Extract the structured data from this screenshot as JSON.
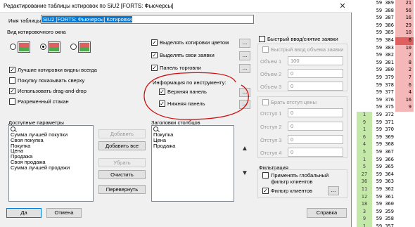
{
  "window": {
    "title": "Редактирование таблицы котировок по SiU2 [FORTS: Фьючерсы]",
    "close": "✕"
  },
  "table_name": {
    "label": "Имя таблицы",
    "value": "SiU2 [FORTS: Фьючерсы] Котировки"
  },
  "view": {
    "label": "Вид котировочного окна",
    "options": [
      "best_quotes_bottom",
      "best_quotes_middle",
      "best_quotes_top"
    ],
    "selected_index": 1
  },
  "checks_left": [
    {
      "label": "Лучшие котировки видны всегда",
      "checked": true
    },
    {
      "label": "Покупку показывать сверху",
      "checked": false
    },
    {
      "label": "Использовать drag-and-drop",
      "checked": true
    },
    {
      "label": "Разреженный стакан",
      "checked": false
    }
  ],
  "checks_mid": [
    {
      "label": "Выделять котировки цветом",
      "checked": true
    },
    {
      "label": "Выделять свои заявки",
      "checked": true
    },
    {
      "label": "Панель торговли",
      "checked": true
    }
  ],
  "info_group": {
    "label": "Информация по инструменту:",
    "items": [
      {
        "label": "Верхняя панель",
        "checked": true
      },
      {
        "label": "Нижняя панель",
        "checked": true
      }
    ]
  },
  "dots": "...",
  "available": {
    "label": "Доступные параметры",
    "items": [
      "Сумма лучшей покупки",
      "Своя покупка",
      "Покупка",
      "Цена",
      "Продажа",
      "Своя продажа",
      "Сумма лучшей продажи"
    ]
  },
  "headers": {
    "label": "Заголовки столбцов",
    "items": [
      "Покупка",
      "Цена",
      "Продажа"
    ]
  },
  "buttons": {
    "add": "Добавить",
    "add_all": "Добавить все",
    "remove": "Убрать",
    "clear": "Очистить",
    "flip": "Перевернуть",
    "ok": "Да",
    "cancel": "Отмена",
    "help": "Справка"
  },
  "right": {
    "fast_orders": "Быстрый ввод/снятие заявки",
    "fast_volume": "Быстрый ввод объема заявки",
    "volumes": [
      {
        "label": "Объем 1",
        "value": "100"
      },
      {
        "label": "Объем 2",
        "value": "0"
      },
      {
        "label": "Объем 3",
        "value": "0"
      }
    ],
    "take_offset": "Брать отступ цены",
    "offsets": [
      {
        "label": "Отступ 1",
        "value": "0"
      },
      {
        "label": "Отступ 2",
        "value": "0"
      },
      {
        "label": "Отступ 3",
        "value": "0"
      },
      {
        "label": "Отступ 4",
        "value": "0"
      }
    ],
    "filter_label": "Фильтрация",
    "global_filter": "Применять глобальный фильтр клиентов",
    "client_filter": "Фильтр клиентов"
  },
  "bg_rows": [
    [
      "",
      "59 389",
      "21"
    ],
    [
      "",
      "59 388",
      "56"
    ],
    [
      "",
      "59 387",
      "16"
    ],
    [
      "",
      "59 386",
      "29"
    ],
    [
      "",
      "59 385",
      "10"
    ],
    [
      "",
      "59 384",
      "6"
    ],
    [
      "",
      "59 383",
      "10"
    ],
    [
      "",
      "59 382",
      "2"
    ],
    [
      "",
      "59 381",
      "8"
    ],
    [
      "",
      "59 380",
      "2"
    ],
    [
      "",
      "59 379",
      "7"
    ],
    [
      "",
      "59 378",
      "6"
    ],
    [
      "",
      "59 377",
      "4"
    ],
    [
      "",
      "59 376",
      "16"
    ],
    [
      "",
      "59 375",
      "9"
    ],
    [
      "1",
      "59 372",
      ""
    ],
    [
      "9",
      "59 371",
      ""
    ],
    [
      "1",
      "59 370",
      ""
    ],
    [
      "6",
      "59 369",
      ""
    ],
    [
      "4",
      "59 368",
      ""
    ],
    [
      "5",
      "59 367",
      ""
    ],
    [
      "1",
      "59 366",
      ""
    ],
    [
      "5",
      "59 365",
      ""
    ],
    [
      "27",
      "59 364",
      ""
    ],
    [
      "36",
      "59 363",
      ""
    ],
    [
      "11",
      "59 362",
      ""
    ],
    [
      "12",
      "59 361",
      ""
    ],
    [
      "18",
      "59 360",
      ""
    ],
    [
      "3",
      "59 359",
      ""
    ],
    [
      "9",
      "59 358",
      ""
    ],
    [
      "1",
      "59 357",
      ""
    ]
  ],
  "colors": {
    "ask": "#f4b8b8",
    "bid": "#c4e8a8",
    "ask_selected": "#e06060",
    "annotation": "#d01010"
  }
}
